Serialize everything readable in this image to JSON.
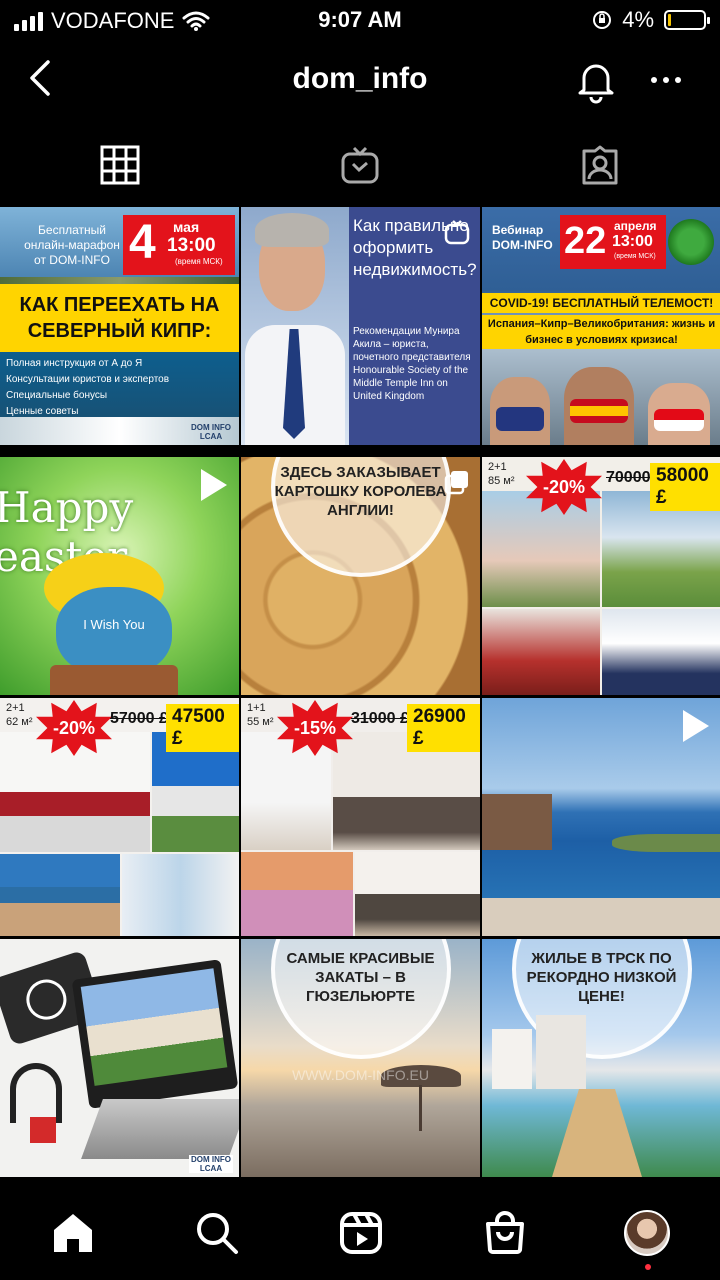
{
  "status_bar": {
    "carrier": "VODAFONE",
    "time": "9:07 AM",
    "battery": "4%",
    "battery_level": 0.04
  },
  "header": {
    "title": "dom_info",
    "icons": [
      "chevron-left-icon",
      "bell-icon",
      "more-icon"
    ]
  },
  "tabs": [
    {
      "name": "grid",
      "icon": "grid-icon",
      "active": true
    },
    {
      "name": "igtv",
      "icon": "igtv-icon",
      "active": false
    },
    {
      "name": "tagged",
      "icon": "tagged-person-icon",
      "active": false
    }
  ],
  "posts": {
    "p1": {
      "intro": "Бесплатный онлайн-марафон от DOM-INFO",
      "day": "4",
      "month": "мая",
      "time": "13:00",
      "tz": "(время МСК)",
      "headline": "КАК ПЕРЕЕХАТЬ НА СЕВЕРНЫЙ КИПР:",
      "bullets": [
        "Полная инструкция от А до Я",
        "Консультации юристов и экспертов",
        "Специальные бонусы",
        "Ценные советы"
      ],
      "logo": "DOM INFO LCAA"
    },
    "p2": {
      "question": "Как правильно оформить недвижимость?",
      "body": "Рекомендации Мунира Акила – юриста, почетного представителя Honourable Society of the Middle Temple Inn on United Kingdom"
    },
    "p3": {
      "intro": "Вебинар DOM-INFO",
      "day": "22",
      "month": "апреля",
      "time": "13:00",
      "tz": "(время МСК)",
      "line1": "COVID-19! БЕСПЛАТНЫЙ ТЕЛЕМОСТ!",
      "line2": "Испания–Кипр–Великобритания: жизнь и бизнес в условиях кризиса!"
    },
    "p4": {
      "headline": "Happy easter",
      "sub": "I Wish You"
    },
    "p5": {
      "caption": "ЗДЕСЬ ЗАКАЗЫВАЕТ КАРТОШКУ КОРОЛЕВА АНГЛИИ!"
    },
    "p6": {
      "rooms": "2+1",
      "area": "85 м²",
      "discount": "-20%",
      "old_price": "70000 £",
      "new_price": "58000 £"
    },
    "p7": {
      "rooms": "2+1",
      "area": "62 м²",
      "discount": "-20%",
      "old_price": "57000 £",
      "new_price": "47500 £"
    },
    "p8": {
      "rooms": "1+1",
      "area": "55 м²",
      "discount": "-15%",
      "old_price": "31000 £",
      "new_price": "26900 £"
    },
    "p10": {
      "logo": "DOM INFO LCAA"
    },
    "p11": {
      "caption": "САМЫЕ КРАСИВЫЕ ЗАКАТЫ – В ГЮЗЕЛЬЮРТЕ",
      "watermark": "WWW.DOM-INFO.EU"
    },
    "p12": {
      "caption": "ЖИЛЬЕ В ТРСК ПО РЕКОРДНО НИЗКОЙ ЦЕНЕ!"
    }
  },
  "bottom_nav": [
    "home-icon",
    "search-icon",
    "reels-icon",
    "shop-icon",
    "profile-avatar"
  ]
}
